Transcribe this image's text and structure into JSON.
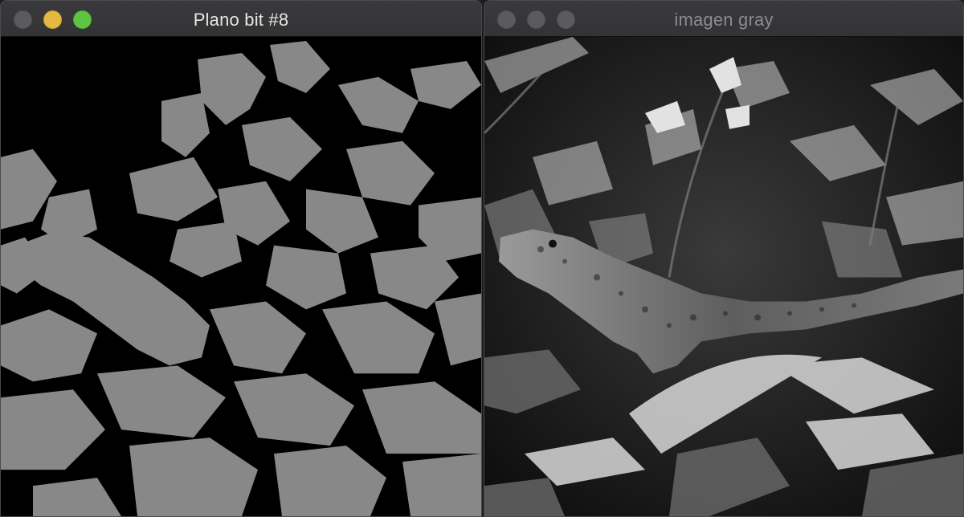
{
  "windows": [
    {
      "title": "Plano bit #8",
      "active": true,
      "content": "binary bit-plane image of lizard among leaves (gray on black)"
    },
    {
      "title": "imagen gray",
      "active": false,
      "content": "grayscale photo of lizard among leaves"
    }
  ],
  "colors": {
    "bitplane_fg": "#888888",
    "bitplane_bg": "#000000",
    "titlebar": "#363638",
    "close_dim": "#5b5b5f",
    "minimize": "#e3b942",
    "zoom": "#5fc443"
  }
}
